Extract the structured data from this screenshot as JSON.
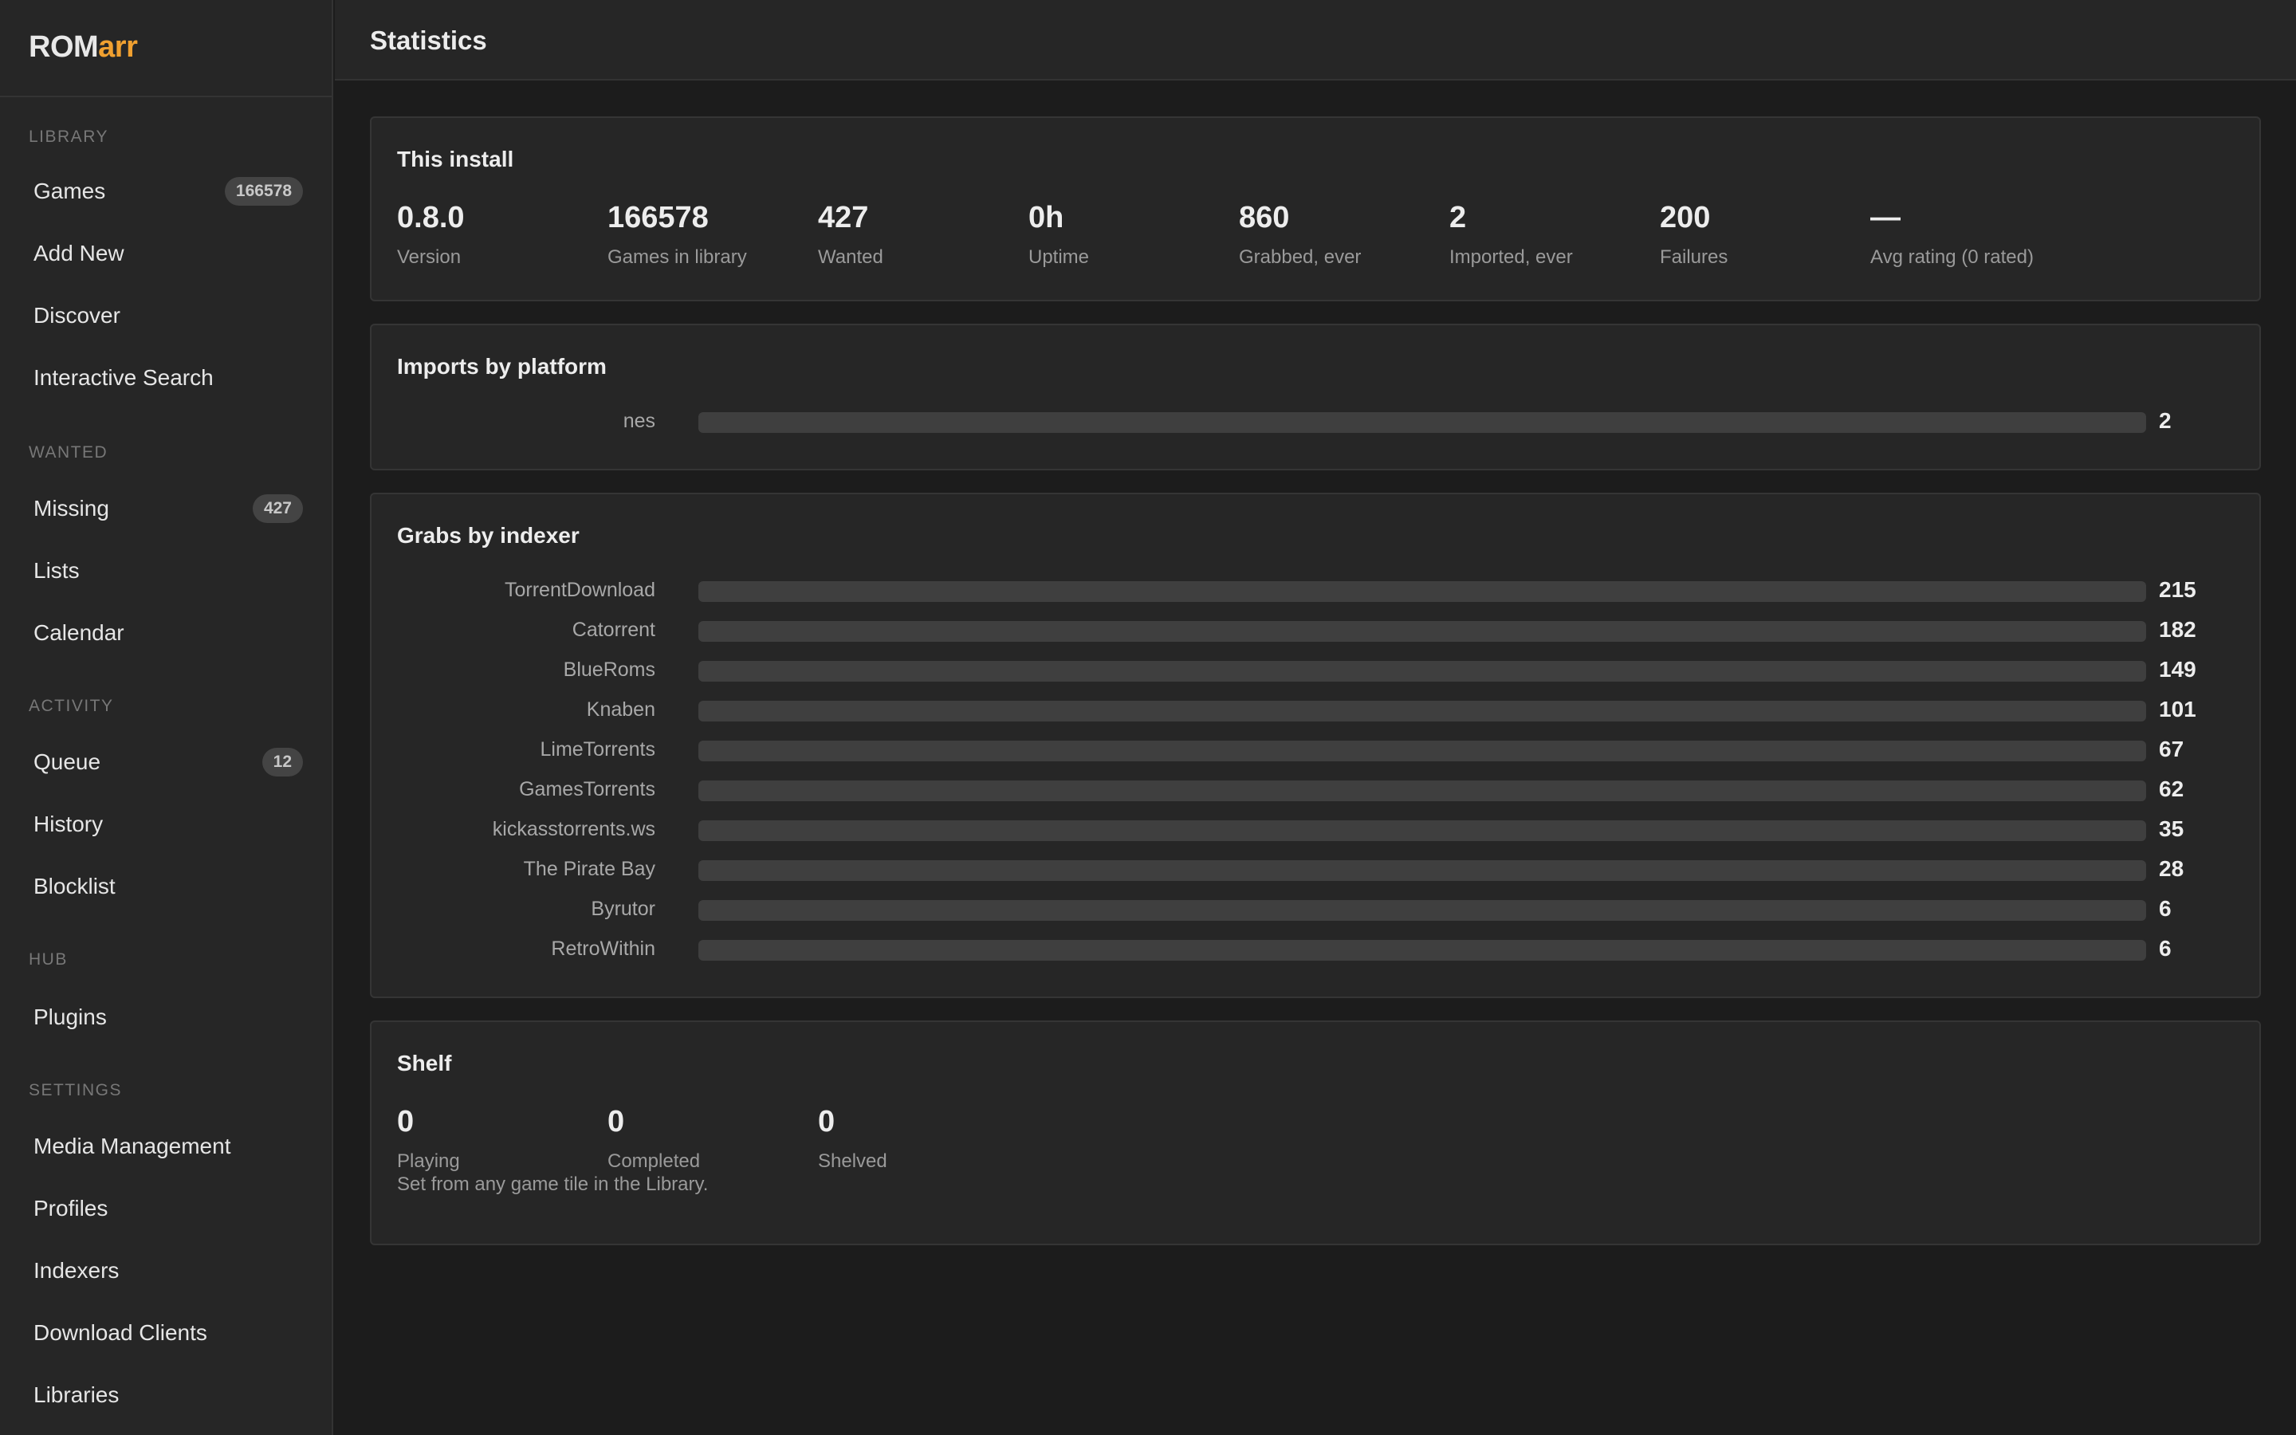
{
  "brand": {
    "prefix": "ROM",
    "accent": "arr"
  },
  "sidebar": {
    "sections": [
      {
        "label": "LIBRARY",
        "items": [
          {
            "label": "Games",
            "badge": "166578"
          },
          {
            "label": "Add New"
          },
          {
            "label": "Discover"
          },
          {
            "label": "Interactive Search"
          }
        ]
      },
      {
        "label": "WANTED",
        "items": [
          {
            "label": "Missing",
            "badge": "427"
          },
          {
            "label": "Lists"
          },
          {
            "label": "Calendar"
          }
        ]
      },
      {
        "label": "ACTIVITY",
        "items": [
          {
            "label": "Queue",
            "badge": "12"
          },
          {
            "label": "History"
          },
          {
            "label": "Blocklist"
          }
        ]
      },
      {
        "label": "HUB",
        "items": [
          {
            "label": "Plugins"
          }
        ]
      },
      {
        "label": "SETTINGS",
        "items": [
          {
            "label": "Media Management"
          },
          {
            "label": "Profiles"
          },
          {
            "label": "Indexers"
          },
          {
            "label": "Download Clients"
          },
          {
            "label": "Libraries"
          }
        ]
      }
    ]
  },
  "header": {
    "title": "Statistics"
  },
  "install": {
    "title": "This install",
    "stats": [
      {
        "value": "0.8.0",
        "label": "Version"
      },
      {
        "value": "166578",
        "label": "Games in library"
      },
      {
        "value": "427",
        "label": "Wanted"
      },
      {
        "value": "0h",
        "label": "Uptime"
      },
      {
        "value": "860",
        "label": "Grabbed, ever"
      },
      {
        "value": "2",
        "label": "Imported, ever"
      },
      {
        "value": "200",
        "label": "Failures"
      },
      {
        "value": "—",
        "label": "Avg rating (0 rated)"
      }
    ]
  },
  "imports": {
    "title": "Imports by platform",
    "rows": [
      {
        "name": "nes",
        "count": "2",
        "fill": 1.0
      }
    ]
  },
  "grabs": {
    "title": "Grabs by indexer",
    "rows": [
      {
        "name": "TorrentDownload",
        "count": "215",
        "fill": 1.0
      },
      {
        "name": "Catorrent",
        "count": "182",
        "fill": 1.0
      },
      {
        "name": "BlueRoms",
        "count": "149",
        "fill": 1.0
      },
      {
        "name": "Knaben",
        "count": "101",
        "fill": 1.0
      },
      {
        "name": "LimeTorrents",
        "count": "67",
        "fill": 1.0
      },
      {
        "name": "GamesTorrents",
        "count": "62",
        "fill": 1.0
      },
      {
        "name": "kickasstorrents.ws",
        "count": "35",
        "fill": 1.0
      },
      {
        "name": "The Pirate Bay",
        "count": "28",
        "fill": 1.0
      },
      {
        "name": "Byrutor",
        "count": "6",
        "fill": 1.0
      },
      {
        "name": "RetroWithin",
        "count": "6",
        "fill": 1.0
      }
    ]
  },
  "shelf": {
    "title": "Shelf",
    "stats": [
      {
        "value": "0",
        "label": "Playing"
      },
      {
        "value": "0",
        "label": "Completed"
      },
      {
        "value": "0",
        "label": "Shelved"
      }
    ],
    "note": "Set from any game tile in the Library."
  }
}
